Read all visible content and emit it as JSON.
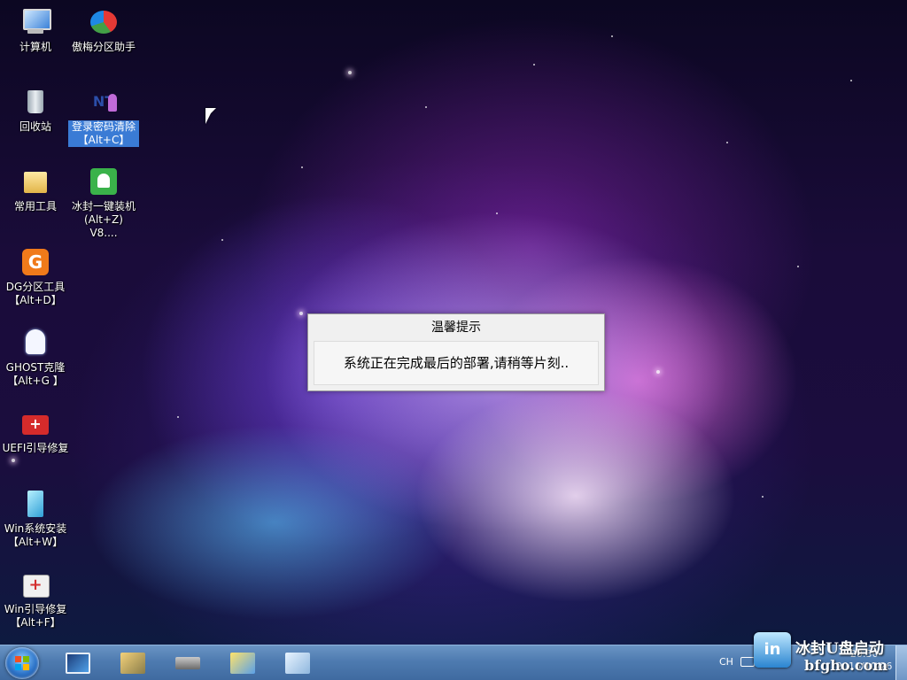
{
  "desktop": {
    "icons": [
      {
        "label": "计算机",
        "label2": ""
      },
      {
        "label": "傲梅分区助手",
        "label2": ""
      },
      {
        "label": "回收站",
        "label2": ""
      },
      {
        "label": "登录密码清除",
        "label2": "【Alt+C】"
      },
      {
        "label": "常用工具",
        "label2": ""
      },
      {
        "label": "冰封一键装机",
        "label2": "(Alt+Z) V8...."
      },
      {
        "label": "DG分区工具",
        "label2": "【Alt+D】"
      },
      {
        "label": "GHOST克隆",
        "label2": "【Alt+G 】"
      },
      {
        "label": "UEFI引导修复",
        "label2": ""
      },
      {
        "label": "Win系统安装",
        "label2": "【Alt+W】"
      },
      {
        "label": "Win引导修复",
        "label2": "【Alt+F】"
      }
    ]
  },
  "dialog": {
    "title": "温馨提示",
    "message": "系统正在完成最后的部署,请稍等片刻.."
  },
  "taskbar": {
    "tray_lang": "CH",
    "brand_text": "冰封U盘启动",
    "brand_url": "bfgho.com",
    "brand_icon_text": "in",
    "clock_time": "20:30",
    "clock_date": "2016/10/26"
  }
}
